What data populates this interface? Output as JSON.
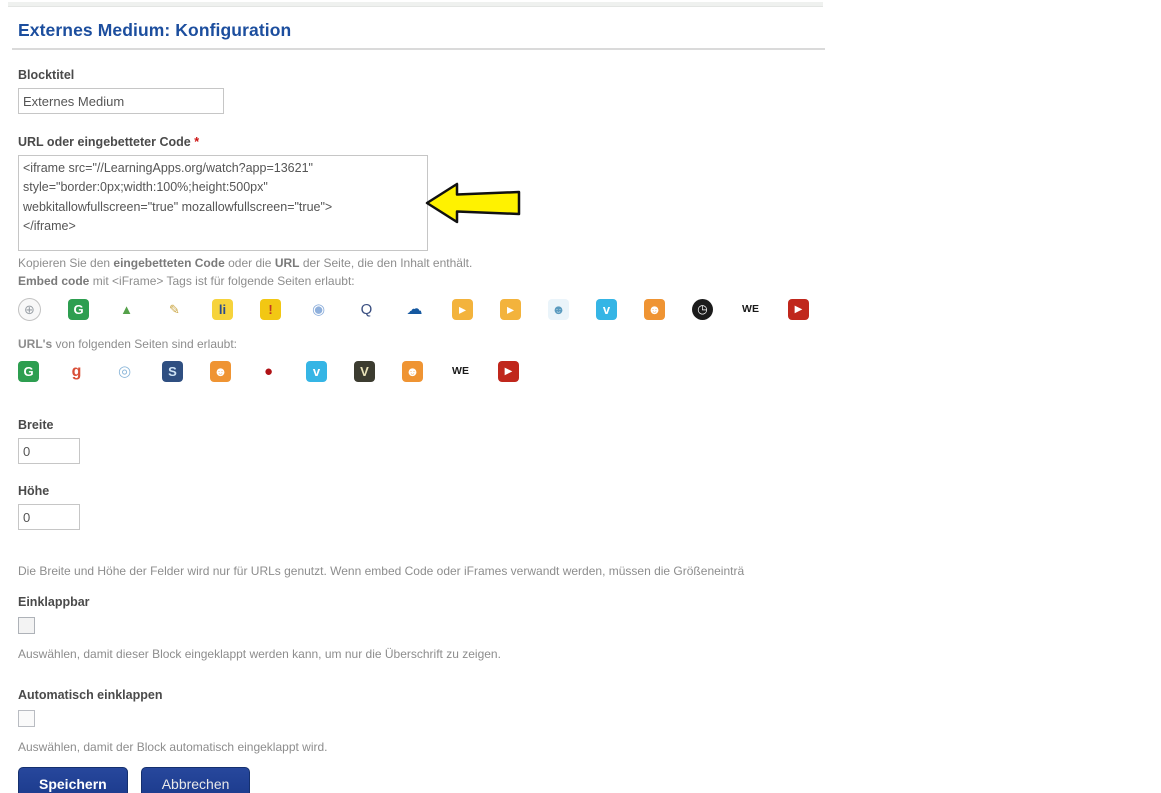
{
  "page": {
    "title": "Externes Medium: Konfiguration"
  },
  "form": {
    "blocktitel": {
      "label": "Blocktitel",
      "value": "Externes Medium"
    },
    "url_code": {
      "label": "URL oder eingebetteter Code ",
      "required_mark": "*",
      "value": "<iframe src=\"//LearningApps.org/watch?app=13621\"\nstyle=\"border:0px;width:100%;height:500px\"\nwebkitallowfullscreen=\"true\" mozallowfullscreen=\"true\">\n</iframe>",
      "hint1_pre": "Kopieren Sie den ",
      "hint1_bold1": "eingebetteten Code",
      "hint1_mid": " oder die ",
      "hint1_bold2": "URL",
      "hint1_post": " der Seite, die den Inhalt enthält.",
      "hint2_bold": "Embed code",
      "hint2_rest": " mit <iFrame> Tags ist für folgende Seiten erlaubt:",
      "url_allowed_bold": "URL's",
      "url_allowed_rest": " von folgenden Seiten sind erlaubt:"
    },
    "embed_icons": [
      {
        "name": "globe-icon",
        "glyph": "⊕",
        "bg": "#f8f8f8",
        "fg": "#9aa0a6",
        "shape": "circle",
        "border": "#c2c2c2"
      },
      {
        "name": "google-docs-icon",
        "glyph": "G",
        "bg": "#2d9e50",
        "fg": "#ffffff",
        "shape": "square",
        "bold": true
      },
      {
        "name": "google-drive-icon",
        "glyph": "▲",
        "bg": "",
        "fg": "#55a14a",
        "shape": "none"
      },
      {
        "name": "pencil-sketch-icon",
        "glyph": "✎",
        "bg": "",
        "fg": "#c8a23c",
        "shape": "none"
      },
      {
        "name": "learningapps-icon",
        "glyph": "li",
        "bg": "#f6d33c",
        "fg": "#2a4b8d",
        "shape": "square",
        "bold": true
      },
      {
        "name": "lino-icon",
        "glyph": "!",
        "bg": "#f2c713",
        "fg": "#c23a22",
        "shape": "square",
        "bold": true
      },
      {
        "name": "sphere-icon",
        "glyph": "◉",
        "bg": "",
        "fg": "#8fb0dc",
        "shape": "none",
        "fs": "15px"
      },
      {
        "name": "quizlet-icon",
        "glyph": "Q",
        "bg": "",
        "fg": "#3b4f81",
        "shape": "none",
        "fs": "15px"
      },
      {
        "name": "onedrive-icon",
        "glyph": "☁",
        "bg": "",
        "fg": "#1558a0",
        "shape": "none",
        "fs": "16px"
      },
      {
        "name": "padlet-icon",
        "glyph": "▸",
        "bg": "#f3b33c",
        "fg": "#ffffff",
        "shape": "square",
        "fs": "14px"
      },
      {
        "name": "padlet-icon-2",
        "glyph": "▸",
        "bg": "#f3b33c",
        "fg": "#ffffff",
        "shape": "square",
        "fs": "14px"
      },
      {
        "name": "slideshare-icon",
        "glyph": "☻",
        "bg": "#eaf4fa",
        "fg": "#5b9bbf",
        "shape": "square"
      },
      {
        "name": "vimeo-icon",
        "glyph": "v",
        "bg": "#35b5e5",
        "fg": "#ffffff",
        "shape": "square",
        "bold": true
      },
      {
        "name": "voki-icon",
        "glyph": "☻",
        "bg": "#ef9433",
        "fg": "#ffffff",
        "shape": "square"
      },
      {
        "name": "clock-icon",
        "glyph": "◷",
        "bg": "#1b1b1b",
        "fg": "#ffffff",
        "shape": "circle",
        "fs": "12px"
      },
      {
        "name": "wevideo-icon",
        "glyph": "WE",
        "bg": "",
        "fg": "#1a1a1a",
        "shape": "none",
        "bold": true,
        "fs": "10.5px"
      },
      {
        "name": "youtube-icon",
        "glyph": "▶",
        "bg": "#c0271c",
        "fg": "#ffffff",
        "shape": "square",
        "fs": "10px"
      }
    ],
    "url_icons": [
      {
        "name": "google-docs-icon",
        "glyph": "G",
        "bg": "#2d9e50",
        "fg": "#ffffff",
        "shape": "square",
        "bold": true
      },
      {
        "name": "google-icon",
        "glyph": "g",
        "bg": "",
        "fg": "#d94f38",
        "shape": "none",
        "bold": true,
        "fs": "16px"
      },
      {
        "name": "rings-icon",
        "glyph": "◎",
        "bg": "",
        "fg": "#8ab6d9",
        "shape": "none",
        "fs": "15px"
      },
      {
        "name": "s-wave-icon",
        "glyph": "S",
        "bg": "#2f4f81",
        "fg": "#cfe3f5",
        "shape": "square",
        "bold": true
      },
      {
        "name": "voki-icon",
        "glyph": "☻",
        "bg": "#ef9433",
        "fg": "#ffffff",
        "shape": "square"
      },
      {
        "name": "apple-icon",
        "glyph": "●",
        "bg": "",
        "fg": "#b01216",
        "shape": "none",
        "fs": "15px"
      },
      {
        "name": "vimeo-icon",
        "glyph": "v",
        "bg": "#35b5e5",
        "fg": "#ffffff",
        "shape": "square",
        "bold": true
      },
      {
        "name": "v-badge-icon",
        "glyph": "V",
        "bg": "#3c3c30",
        "fg": "#e9e3b9",
        "shape": "square",
        "bold": true
      },
      {
        "name": "voki-icon-2",
        "glyph": "☻",
        "bg": "#ef9433",
        "fg": "#ffffff",
        "shape": "square"
      },
      {
        "name": "wevideo-icon",
        "glyph": "WE",
        "bg": "",
        "fg": "#1a1a1a",
        "shape": "none",
        "bold": true,
        "fs": "10.5px"
      },
      {
        "name": "youtube-icon",
        "glyph": "▶",
        "bg": "#c0271c",
        "fg": "#ffffff",
        "shape": "square",
        "fs": "10px"
      }
    ],
    "breite": {
      "label": "Breite",
      "value": "0"
    },
    "hoehe": {
      "label": "Höhe",
      "value": "0"
    },
    "size_hint": "Die Breite und Höhe der Felder wird nur für URLs genutzt. Wenn embed Code oder iFrames verwandt werden, müssen die Größeneinträ",
    "einklappbar": {
      "label": "Einklappbar",
      "hint": "Auswählen, damit dieser Block eingeklappt werden kann, um nur die Überschrift zu zeigen."
    },
    "auto_einklappen": {
      "label": "Automatisch einklappen",
      "hint": "Auswählen, damit der Block automatisch eingeklappt wird."
    },
    "buttons": {
      "save": "Speichern",
      "cancel": "Abbrechen"
    }
  },
  "colors": {
    "title": "#1c4e9e",
    "button": "#1f3d8c",
    "arrow": "#fff200"
  }
}
